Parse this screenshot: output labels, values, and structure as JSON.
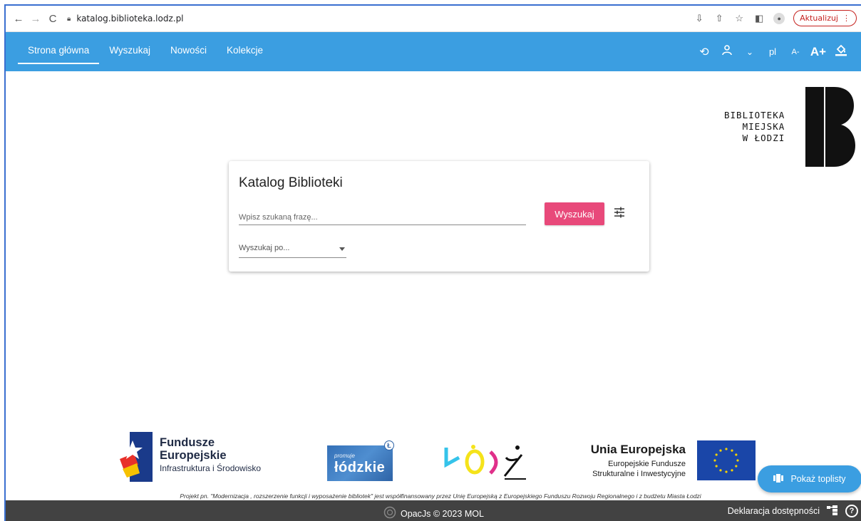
{
  "browser": {
    "url": "katalog.biblioteka.lodz.pl",
    "update_label": "Aktualizuj",
    "icons": [
      "back-icon",
      "forward-icon",
      "reload-icon",
      "lock-icon",
      "install-icon",
      "share-icon",
      "star-icon",
      "sidebar-icon",
      "profile-icon",
      "more-icon"
    ]
  },
  "appbar": {
    "menu": [
      {
        "label": "Strona główna",
        "active": true
      },
      {
        "label": "Wyszukaj"
      },
      {
        "label": "Nowości"
      },
      {
        "label": "Kolekcje"
      }
    ],
    "language": "pl",
    "font_small": "A-",
    "font_large": "A+",
    "icons": [
      "history-icon",
      "user-icon",
      "chevron-down-icon",
      "contrast-icon"
    ]
  },
  "library": {
    "line1": "BIBLIOTEKA",
    "line2": "MIEJSKA",
    "line3": "W ŁODZI"
  },
  "search": {
    "title": "Katalog Biblioteki",
    "placeholder": "Wpisz szukaną frazę...",
    "button": "Wyszukaj",
    "select_placeholder": "Wyszukaj po..."
  },
  "sponsors": {
    "fe_line1": "Fundusze",
    "fe_line2": "Europejskie",
    "fe_line3": "Infrastruktura i Środowisko",
    "lodzkie_small": "promuje",
    "lodzkie_big": "łódzkie",
    "lodzkie_badge": "Ł",
    "ue_line1": "Unia Europejska",
    "ue_line2": "Europejskie Fundusze",
    "ue_line3": "Strukturalne i Inwestycyjne"
  },
  "toplist_button": "Pokaż toplisty",
  "project_note": "Projekt pn. \"Modernizacja , rozszerzenie funkcji i wyposażenie bibliotek\" jest współfinansowany przez Unię Europejską z Europejskiego Funduszu Rozwoju Regionalnego i z budżetu Miasta Łodzi",
  "footer": {
    "copyright": "OpacJs © 2023  MOL",
    "accessibility": "Deklaracja dostępności",
    "help": "?"
  }
}
